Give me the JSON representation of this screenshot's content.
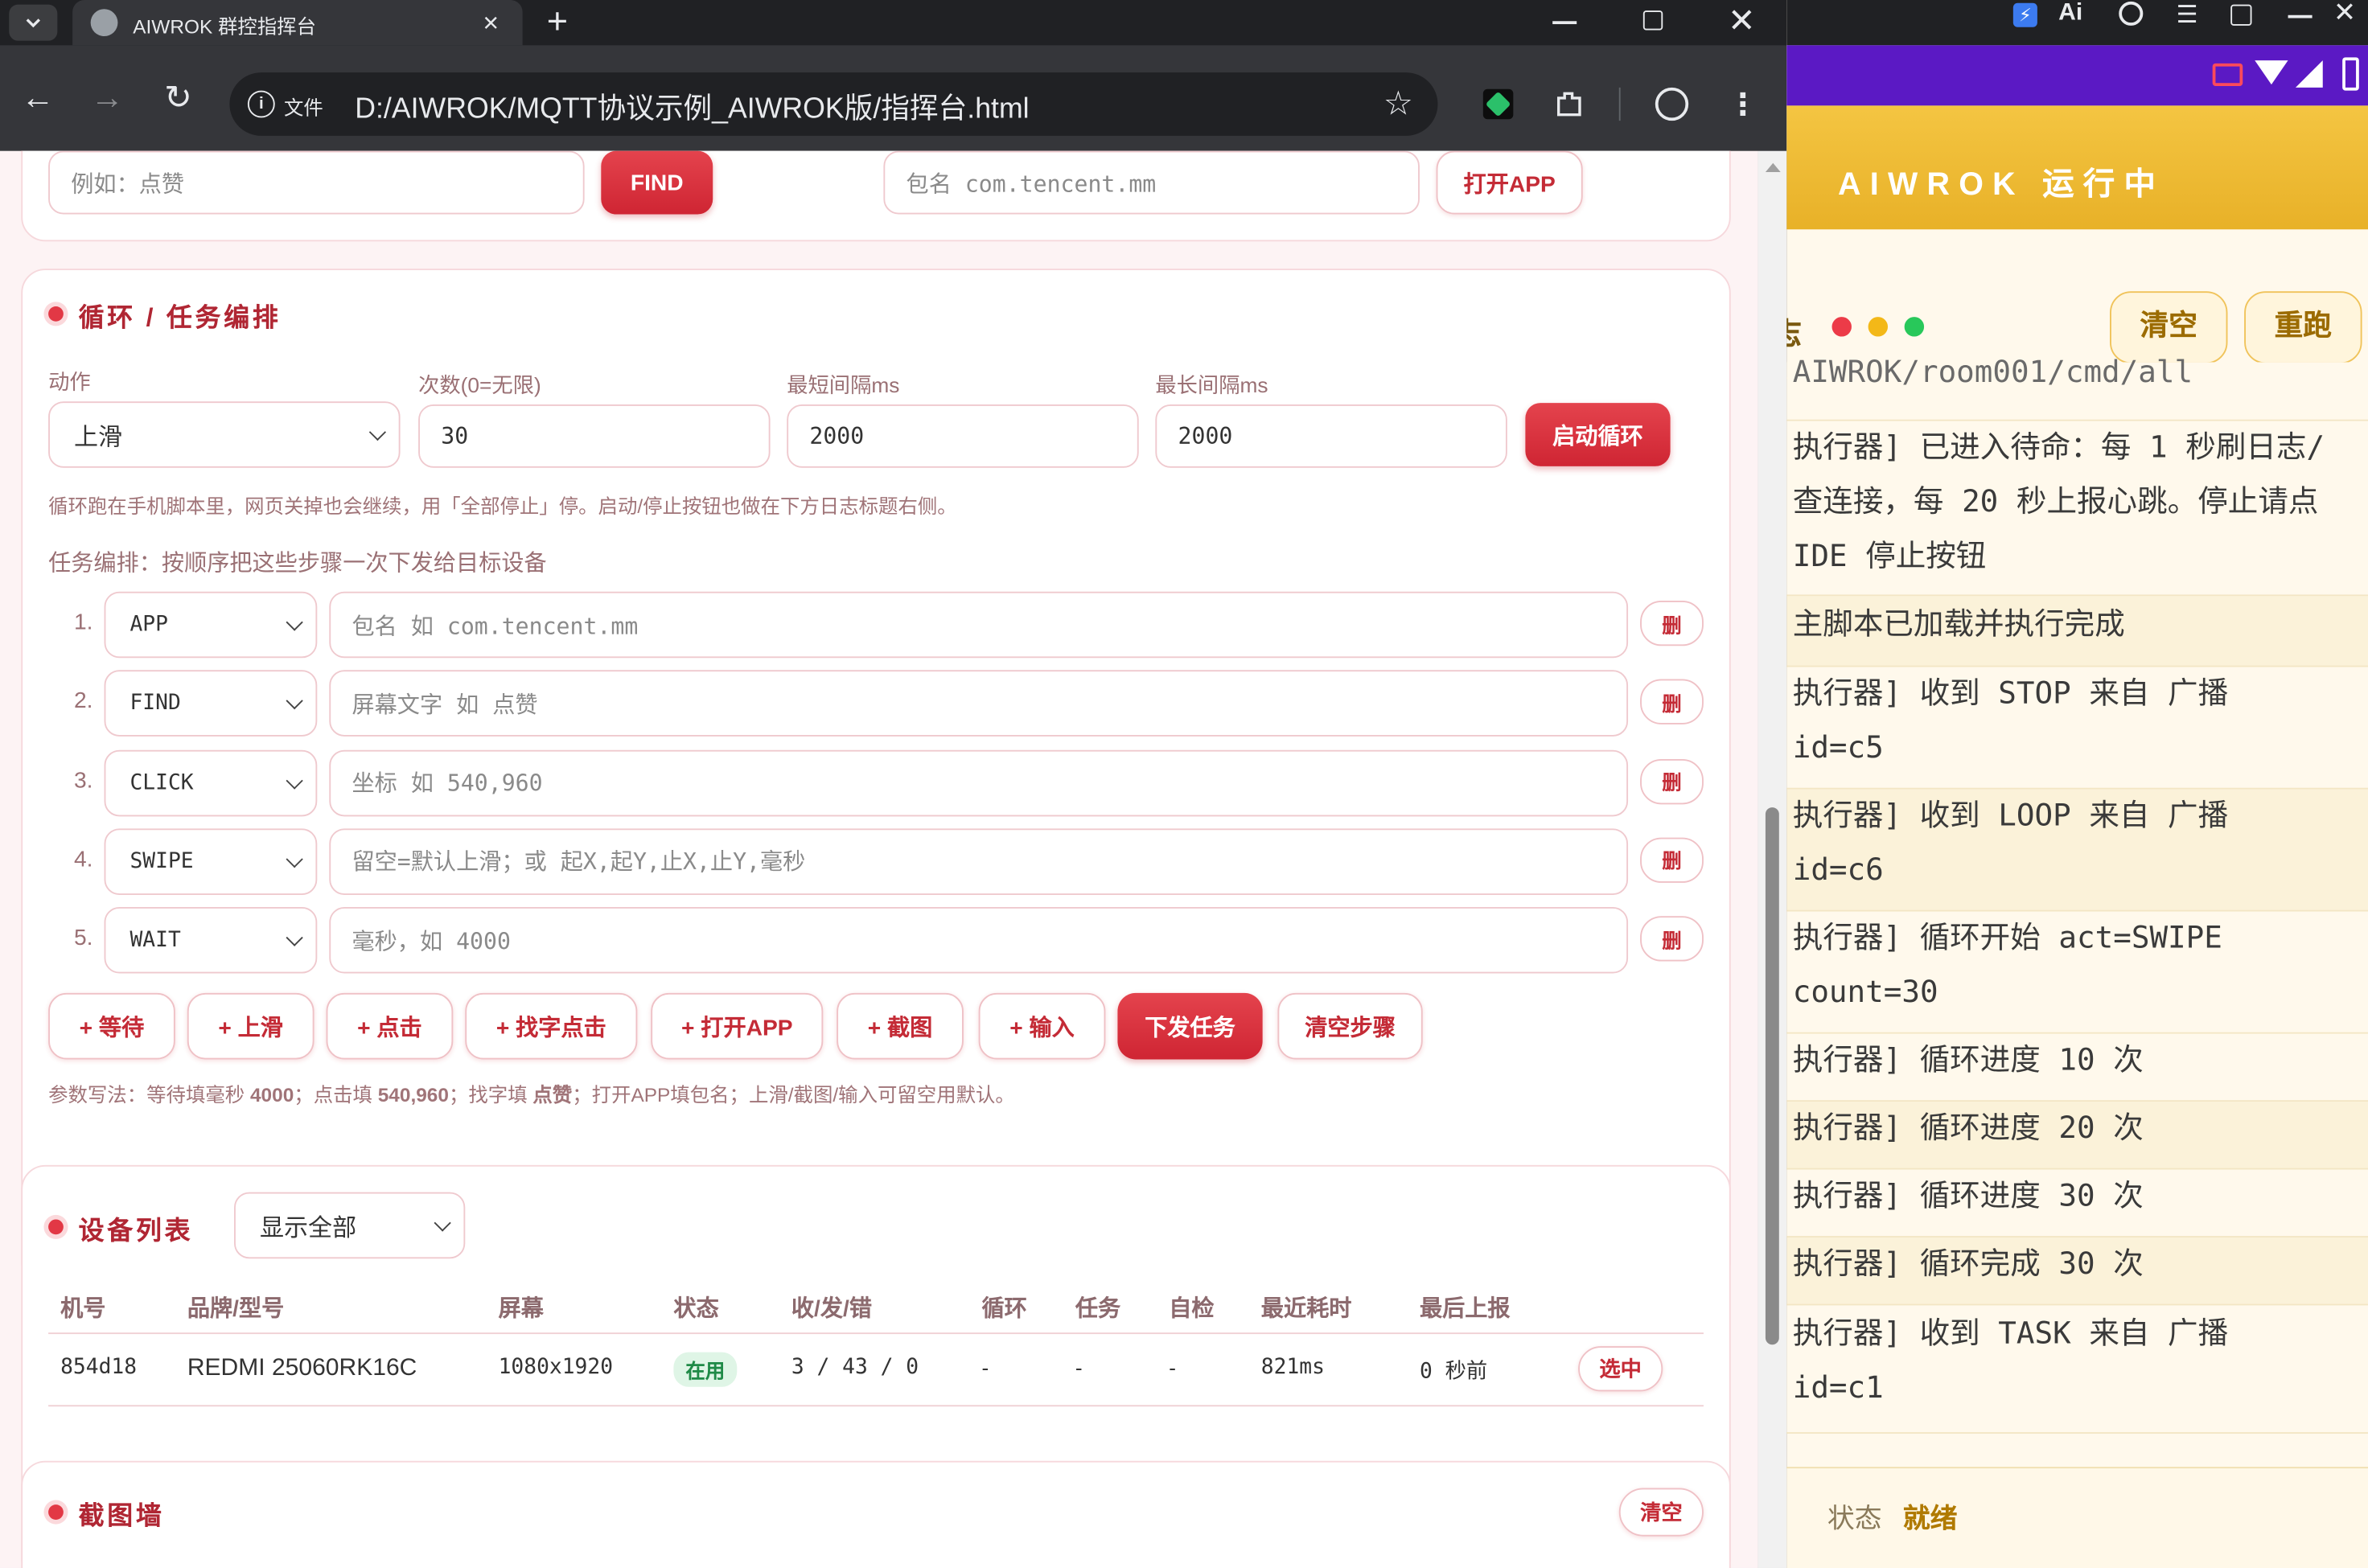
{
  "browser": {
    "tab_title": "AIWROK 群控指挥台",
    "new_tab": "+",
    "file_label": "文件",
    "url": "D:/AIWROK/MQTT协议示例_AIWROK版/指挥台.html"
  },
  "top_row": {
    "find_placeholder": "例如：点赞",
    "find_button": "FIND",
    "pkg_placeholder": "包名 com.tencent.mm",
    "open_app_button": "打开APP"
  },
  "loop": {
    "title": "循环 / 任务编排",
    "action_label": "动作",
    "action_value": "上滑",
    "count_label": "次数(0=无限)",
    "count_value": "30",
    "min_label": "最短间隔ms",
    "min_value": "2000",
    "max_label": "最长间隔ms",
    "max_value": "2000",
    "start_button": "启动循环",
    "note": "循环跑在手机脚本里，网页关掉也会继续，用「全部停止」停。启动/停止按钮也做在下方日志标题右侧。",
    "task_note": "任务编排：按顺序把这些步骤一次下发给目标设备",
    "steps": [
      {
        "num": "1.",
        "type": "APP",
        "placeholder": "包名 如 com.tencent.mm",
        "del": "删"
      },
      {
        "num": "2.",
        "type": "FIND",
        "placeholder": "屏幕文字 如 点赞",
        "del": "删"
      },
      {
        "num": "3.",
        "type": "CLICK",
        "placeholder": "坐标 如 540,960",
        "del": "删"
      },
      {
        "num": "4.",
        "type": "SWIPE",
        "placeholder": "留空=默认上滑；或 起X,起Y,止X,止Y,毫秒",
        "del": "删"
      },
      {
        "num": "5.",
        "type": "WAIT",
        "placeholder": "毫秒，如 4000",
        "del": "删"
      }
    ],
    "add_buttons": [
      "+ 等待",
      "+ 上滑",
      "+ 点击",
      "+ 找字点击",
      "+ 打开APP",
      "+ 截图",
      "+ 输入"
    ],
    "send_button": "下发任务",
    "clear_button": "清空步骤",
    "param_note": {
      "p1": "参数写法：等待填毫秒 ",
      "b1": "4000",
      "p2": "；点击填 ",
      "b2": "540,960",
      "p3": "；找字填 ",
      "b3": "点赞",
      "p4": "；打开APP填包名；上滑/截图/输入可留空用默认。"
    }
  },
  "devices": {
    "title": "设备列表",
    "filter": "显示全部",
    "headers": [
      "机号",
      "品牌/型号",
      "屏幕",
      "状态",
      "收/发/错",
      "循环",
      "任务",
      "自检",
      "最近耗时",
      "最后上报"
    ],
    "rows": [
      {
        "id": "854d18",
        "model": "REDMI 25060RK16C",
        "screen": "1080x1920",
        "status": "在用",
        "counts": "3 / 43 / 0",
        "loop": "-",
        "task": "-",
        "check": "-",
        "latency": "821ms",
        "last": "0 秒前",
        "select": "选中"
      }
    ]
  },
  "screenshots": {
    "title": "截图墙",
    "clear_button": "清空"
  },
  "phone": {
    "banner": "AIWROK 运行中",
    "title_frag": "志",
    "clear_button": "清空",
    "rerun_button": "重跑",
    "logs": [
      "AIWROK/room001/cmd/all",
      "执行器] 已进入待命：每 1 秒刷日志/",
      "查连接，每 20 秒上报心跳。停止请点",
      "IDE 停止按钮",
      "主脚本已加载并执行完成",
      "执行器] 收到 STOP 来自 广播",
      "id=c5",
      "执行器] 收到 LOOP 来自 广播",
      "id=c6",
      "执行器] 循环开始 act=SWIPE",
      "count=30",
      "执行器] 循环进度 10 次",
      "执行器] 循环进度 20 次",
      "执行器] 循环进度 30 次",
      "执行器] 循环完成 30 次",
      "执行器] 收到 TASK 来自 广播",
      "id=c1"
    ],
    "status_label": "状态",
    "status_value": "就绪"
  },
  "colors": {
    "accent": "#d32f3a",
    "page_bg": "#fdf3f4",
    "banner": "#f2c13a",
    "status_bar": "#5b19c4"
  }
}
